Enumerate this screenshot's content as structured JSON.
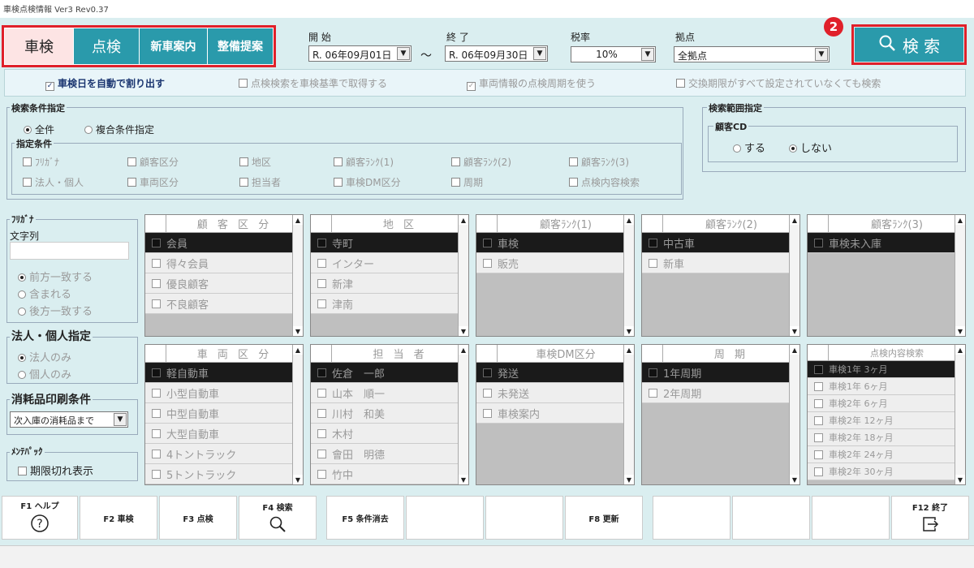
{
  "title": "車検点検情報 Ver3 Rev0.37",
  "tabs": [
    "車検",
    "点検",
    "新車案内",
    "整備提案"
  ],
  "period": {
    "start_label": "開 始",
    "end_label": "終 了",
    "start_value": "R. 06年09月01日",
    "end_value": "R. 06年09月30日",
    "tilde": "〜"
  },
  "tax": {
    "label": "税率",
    "value": "10%"
  },
  "base": {
    "label": "拠点",
    "value": "全拠点"
  },
  "search": {
    "label": "検 索",
    "badge": "2"
  },
  "options": [
    {
      "text": "車検日を自動で割り出す",
      "checked": true,
      "dim": false
    },
    {
      "text": "点検検索を車検基準で取得する",
      "checked": false,
      "dim": true
    },
    {
      "text": "車両情報の点検周期を使う",
      "checked": true,
      "dim": true
    },
    {
      "text": "交換期限がすべて設定されていなくても検索",
      "checked": false,
      "dim": true
    }
  ],
  "cond": {
    "title": "検索条件指定",
    "all": "全件",
    "multi": "複合条件指定",
    "spec_title": "指定条件",
    "checks": [
      "ﾌﾘｶﾞﾅ",
      "顧客区分",
      "地区",
      "顧客ﾗﾝｸ(1)",
      "顧客ﾗﾝｸ(2)",
      "顧客ﾗﾝｸ(3)",
      "法人・個人",
      "車両区分",
      "担当者",
      "車検DM区分",
      "周期",
      "点検内容検索"
    ]
  },
  "range": {
    "title": "検索範囲指定",
    "cd_title": "顧客CD",
    "yes": "する",
    "no": "しない"
  },
  "furigana": {
    "title": "ﾌﾘｶﾞﾅ",
    "sub": "文字列",
    "opts": [
      "前方一致する",
      "含まれる",
      "後方一致する"
    ]
  },
  "corp": {
    "title": "法人・個人指定",
    "opts": [
      "法人のみ",
      "個人のみ"
    ]
  },
  "consum": {
    "title": "消耗品印刷条件",
    "value": "次入庫の消耗品まで"
  },
  "maint": {
    "title": "ﾒﾝﾃﾊﾟｯｸ",
    "check": "期限切れ表示"
  },
  "lists": [
    {
      "h": "顧 客 区 分",
      "rows": [
        "会員",
        "得々会員",
        "優良顧客",
        "不良顧客"
      ]
    },
    {
      "h": "地 区",
      "rows": [
        "寺町",
        "インター",
        "新津",
        "津南"
      ]
    },
    {
      "h": "顧客ﾗﾝｸ(1)",
      "rows": [
        "車検",
        "販売"
      ]
    },
    {
      "h": "顧客ﾗﾝｸ(2)",
      "rows": [
        "中古車",
        "新車"
      ]
    },
    {
      "h": "顧客ﾗﾝｸ(3)",
      "rows": [
        "車検未入庫"
      ]
    },
    {
      "h": "車 両 区 分",
      "rows": [
        "軽自動車",
        "小型自動車",
        "中型自動車",
        "大型自動車",
        "4トントラック",
        "5トントラック"
      ]
    },
    {
      "h": "担 当 者",
      "rows": [
        "佐倉　一郎",
        "山本　順一",
        "川村　和美",
        "木村",
        "會田　明德",
        "竹中"
      ]
    },
    {
      "h": "車検DM区分",
      "rows": [
        "発送",
        "未発送",
        "車検案内"
      ]
    },
    {
      "h": "周 期",
      "rows": [
        "1年周期",
        "2年周期"
      ]
    },
    {
      "h": "点検内容検索",
      "rows": [
        "車検1年 3ヶ月",
        "車検1年 6ヶ月",
        "車検2年 6ヶ月",
        "車検2年 12ヶ月",
        "車検2年 18ヶ月",
        "車検2年 24ヶ月",
        "車検2年 30ヶ月"
      ]
    }
  ],
  "fkeys": [
    {
      "label": "F1 ヘルプ",
      "icon": "?"
    },
    {
      "label": "F2 車検",
      "icon": ""
    },
    {
      "label": "F3 点検",
      "icon": ""
    },
    {
      "label": "F4 検索",
      "icon": "⚲"
    },
    {
      "label": "F5 条件消去",
      "icon": ""
    },
    {
      "label": "",
      "icon": ""
    },
    {
      "label": "",
      "icon": ""
    },
    {
      "label": "F8 更新",
      "icon": ""
    },
    {
      "label": "",
      "icon": ""
    },
    {
      "label": "",
      "icon": ""
    },
    {
      "label": "",
      "icon": ""
    },
    {
      "label": "F12 終了",
      "icon": "⇥"
    }
  ]
}
